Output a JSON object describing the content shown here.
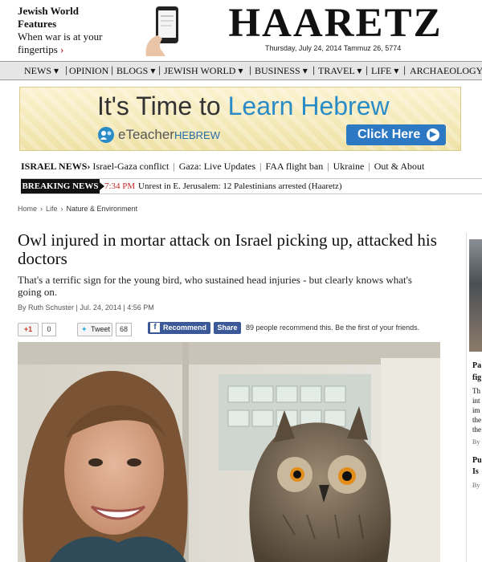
{
  "promo": {
    "line1": "Jewish World",
    "line2": "Features",
    "line3": "When war is at your",
    "line4": "fingertips",
    "arrow": "›"
  },
  "logo": "HAARETZ",
  "date": "Thursday, July 24, 2014 Tammuz 26, 5774",
  "nav": [
    "NEWS",
    "OPINION",
    "BLOGS",
    "JEWISH WORLD",
    "BUSINESS",
    "TRAVEL",
    "LIFE",
    "ARCHAEOLOGY"
  ],
  "nav_caret": "▾",
  "ad": {
    "headline_a": "It's Time to ",
    "headline_b": "Learn Hebrew",
    "brand": "eTeacher",
    "brand_suffix": "HEBREW",
    "cta": "Click Here",
    "cta_icon": "▶"
  },
  "israel_news": {
    "label": "ISRAEL NEWS›",
    "links": [
      "Israel-Gaza conflict",
      "Gaza: Live Updates",
      "FAA flight ban",
      "Ukraine",
      "Out & About"
    ]
  },
  "breaking": {
    "label": "BREAKING NEWS",
    "time": "7:34 PM",
    "headline": "Unrest in E. Jerusalem: 12 Palestinians arrested (Haaretz)"
  },
  "breadcrumb": [
    "Home",
    "Life",
    "Nature & Environment"
  ],
  "breadcrumb_sep": "›",
  "article": {
    "title": "Owl injured in mortar attack on Israel picking up, attacked his doctors",
    "subtitle": "That's a terrific sign for the young bird, who sustained head injuries - but clearly knows what's going on.",
    "byline": "By Ruth Schuster | Jul. 24, 2014 | 4:56 PM"
  },
  "social": {
    "gplus_label": "+1",
    "gplus_count": "0",
    "tweet_label": "Tweet",
    "tweet_count": "68",
    "fb_recommend": "Recommend",
    "fb_share": "Share",
    "fb_text": "89 people recommend this. Be the first of your friends."
  },
  "rail": {
    "t1": "Pa",
    "t2": "fig",
    "t3": "Th",
    "t4": "int",
    "t5": "im",
    "t6": "the",
    "t7": "the",
    "t8": "By",
    "t9": "Pu",
    "t10": "Is",
    "t11": "By"
  }
}
